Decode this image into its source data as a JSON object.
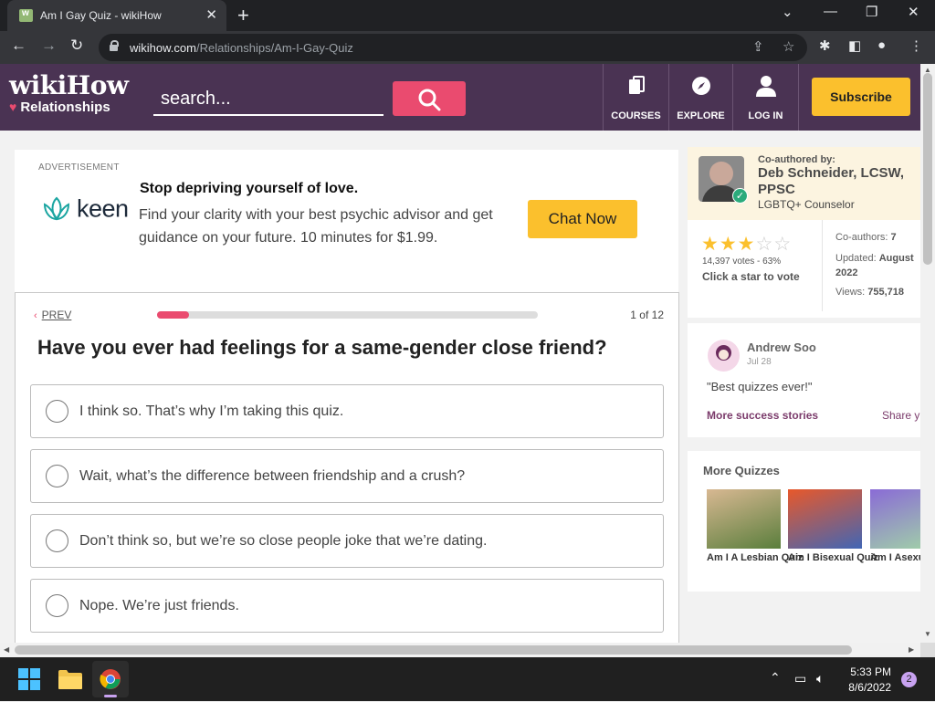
{
  "browser": {
    "tab_title": "Am I Gay Quiz - wikiHow",
    "url_host": "wikihow.com",
    "url_path": "/Relationships/Am-I-Gay-Quiz"
  },
  "header": {
    "logo_word": "wikiHow",
    "logo_sub": "Relationships",
    "search_placeholder": "search...",
    "nav": [
      {
        "label": "COURSES",
        "icon": "courses-icon"
      },
      {
        "label": "EXPLORE",
        "icon": "compass-icon"
      },
      {
        "label": "LOG IN",
        "icon": "user-icon"
      }
    ],
    "subscribe_label": "Subscribe",
    "bg_color": "#4a3353",
    "accent_color": "#ea4b6f"
  },
  "ad": {
    "label": "ADVERTISEMENT",
    "brand": "keen",
    "headline": "Stop depriving yourself of love.",
    "body": "Find your clarity with your best psychic advisor and get guidance on your future. 10 minutes for $1.99.",
    "cta": "Chat Now"
  },
  "quiz": {
    "prev_label": "PREV",
    "progress_fraction": 0.083,
    "count_text": "1 of 12",
    "question": "Have you ever had feelings for a same-gender close friend?",
    "options": [
      "I think so. That’s why I’m taking this quiz.",
      "Wait, what’s the difference between friendship and a crush?",
      "Don’t think so, but we’re so close people joke that we’re dating.",
      "Nope. We’re just friends."
    ]
  },
  "author": {
    "coauthored_label": "Co-authored by:",
    "name": "Deb Schneider, LCSW, PPSC",
    "role": "LGBTQ+ Counselor",
    "rating_stars": 3,
    "votes": "14,397 votes - 63%",
    "vote_cta": "Click a star to vote",
    "coauthors_label": "Co-authors:",
    "coauthors_value": "7",
    "updated_label": "Updated:",
    "updated_value": "August 2022",
    "views_label": "Views:",
    "views_value": "755,718"
  },
  "review": {
    "name": "Andrew Soo",
    "date": "Jul 28",
    "quote": "\"Best quizzes ever!\"",
    "more_stories": "More success stories",
    "share": "Share y"
  },
  "more_quizzes": {
    "title": "More Quizzes",
    "items": [
      {
        "label": "Am I A Lesbian Quiz",
        "colors": [
          "#d8b892",
          "#5a7e3c"
        ]
      },
      {
        "label": "Am I Bisexual Quiz",
        "colors": [
          "#e8582a",
          "#4166b5"
        ]
      },
      {
        "label": "Am I Asexual Quiz",
        "colors": [
          "#8a6bd6",
          "#a2d6a5"
        ]
      }
    ]
  },
  "taskbar": {
    "time": "5:33 PM",
    "date": "8/6/2022",
    "notifications": "2"
  }
}
